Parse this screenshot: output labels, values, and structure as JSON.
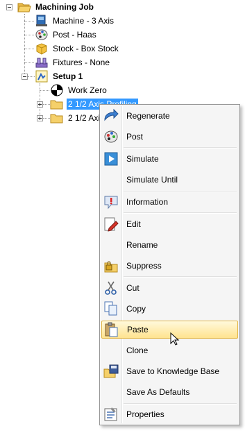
{
  "tree": {
    "root": {
      "label": "Machining Job",
      "icon": "folder-open-icon"
    },
    "children": [
      {
        "label": "Machine - 3 Axis",
        "icon": "machine-icon"
      },
      {
        "label": "Post - Haas",
        "icon": "post-icon"
      },
      {
        "label": "Stock - Box Stock",
        "icon": "stock-box-icon"
      },
      {
        "label": "Fixtures - None",
        "icon": "fixtures-icon"
      }
    ],
    "setup": {
      "label": "Setup 1",
      "icon": "setup-icon",
      "children": [
        {
          "label": "Work Zero",
          "icon": "work-zero-icon"
        },
        {
          "label": "2 1/2 Axis Profiling",
          "icon": "folder-icon",
          "selected": true
        },
        {
          "label": "2 1/2 Axis",
          "icon": "folder-icon"
        }
      ]
    }
  },
  "context_menu": {
    "items": [
      {
        "label": "Regenerate",
        "icon": "regenerate-arrow-icon"
      },
      {
        "label": "Post",
        "icon": "post-icon"
      },
      {
        "label": "Simulate",
        "icon": "play-icon"
      },
      {
        "label": "Simulate Until",
        "icon": ""
      },
      {
        "label": "Information",
        "icon": "information-icon"
      },
      {
        "label": "Edit",
        "icon": "edit-pencil-icon"
      },
      {
        "label": "Rename",
        "icon": ""
      },
      {
        "label": "Suppress",
        "icon": "lock-folder-icon"
      },
      {
        "label": "Cut",
        "icon": "scissors-icon"
      },
      {
        "label": "Copy",
        "icon": "copy-icon"
      },
      {
        "label": "Paste",
        "icon": "paste-icon",
        "hovered": true
      },
      {
        "label": "Clone",
        "icon": ""
      },
      {
        "label": "Save to Knowledge Base",
        "icon": "save-knowledge-base-icon"
      },
      {
        "label": "Save As Defaults",
        "icon": ""
      },
      {
        "label": "Properties",
        "icon": "properties-icon"
      }
    ]
  },
  "colors": {
    "selection": "#3399ff",
    "menu_bg": "#f5f5f5",
    "hover": "#ffe38f"
  }
}
